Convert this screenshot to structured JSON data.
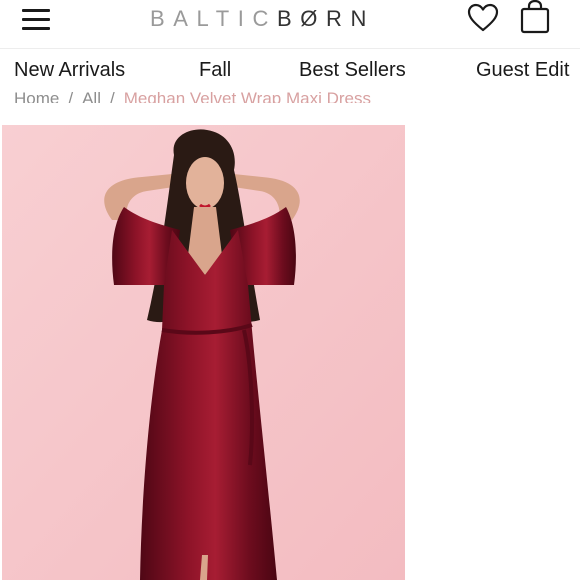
{
  "header": {
    "logo_light": "BALTIC",
    "logo_dark": "BØRN",
    "menu_icon": "hamburger-menu-icon",
    "wishlist_icon": "heart-icon",
    "bag_icon": "shopping-bag-icon"
  },
  "nav": {
    "items": [
      {
        "label": "New Arrivals"
      },
      {
        "label": "Fall"
      },
      {
        "label": "Best Sellers"
      },
      {
        "label": "Guest Edit"
      }
    ]
  },
  "breadcrumb": {
    "home": "Home",
    "all": "All",
    "separator": "/",
    "current": "Meghan Velvet Wrap Maxi Dress"
  },
  "colors": {
    "background": "#f6c7cb",
    "dress": "#7c0f22",
    "breadcrumb_current": "#d8a1a1"
  }
}
